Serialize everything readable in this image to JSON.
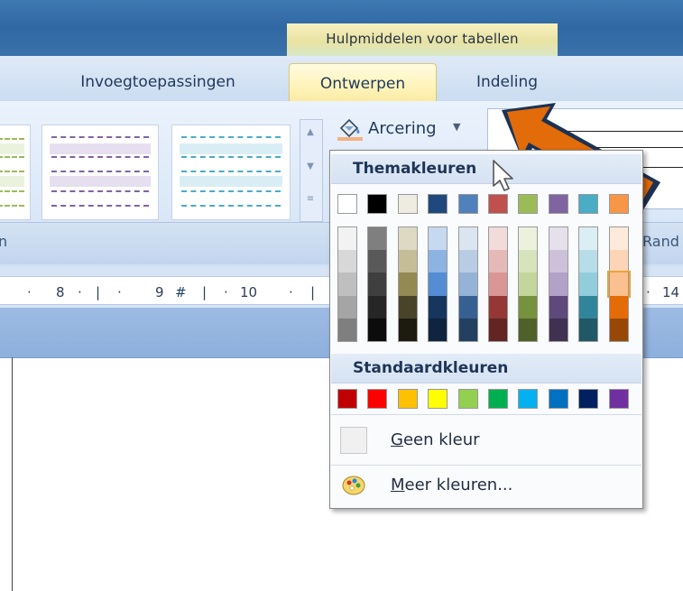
{
  "contextual_tab_title": "Hulpmiddelen voor tabellen",
  "tabs": [
    {
      "label": "Invoegtoepassingen"
    },
    {
      "label": "Ontwerpen"
    },
    {
      "label": "Indeling"
    }
  ],
  "ribbon": {
    "group_label_left": "n",
    "group_label_right": "Rand",
    "shading_button_label": "Arcering"
  },
  "ruler": {
    "labels": [
      "8",
      "9",
      "10",
      "14"
    ]
  },
  "dropdown": {
    "theme_header": "Themakleuren",
    "standard_header": "Standaardkleuren",
    "no_color_label": "Geen kleur",
    "no_color_accel": "G",
    "more_colors_label": "Meer kleuren...",
    "more_colors_accel": "M",
    "theme_top_row": [
      "#ffffff",
      "#000000",
      "#eeece1",
      "#1f497d",
      "#4f81bd",
      "#c0504d",
      "#9bbb59",
      "#8064a2",
      "#4bacc6",
      "#f79646"
    ],
    "theme_shades": [
      [
        "#f2f2f2",
        "#d8d8d8",
        "#bfbfbf",
        "#a5a5a5",
        "#7f7f7f"
      ],
      [
        "#7f7f7f",
        "#595959",
        "#3f3f3f",
        "#262626",
        "#0c0c0c"
      ],
      [
        "#ddd9c3",
        "#c4bd97",
        "#938953",
        "#494429",
        "#1d1b10"
      ],
      [
        "#c6d9f0",
        "#8db3e2",
        "#548dd4",
        "#17365d",
        "#0f243e"
      ],
      [
        "#dbe5f1",
        "#b8cce4",
        "#95b3d7",
        "#366092",
        "#244061"
      ],
      [
        "#f2dcdb",
        "#e5b9b7",
        "#d99694",
        "#953734",
        "#632423"
      ],
      [
        "#ebf1dd",
        "#d7e3bc",
        "#c3d69b",
        "#76923c",
        "#4f6128"
      ],
      [
        "#e5e0ec",
        "#ccc1d9",
        "#b2a2c7",
        "#5f497a",
        "#3f3151"
      ],
      [
        "#dbeef3",
        "#b7dde8",
        "#92cddc",
        "#31859b",
        "#205867"
      ],
      [
        "#fdeada",
        "#fbd5b5",
        "#fac08f",
        "#e36c09",
        "#974806"
      ]
    ],
    "standard_colors": [
      "#c00000",
      "#ff0000",
      "#ffc000",
      "#ffff00",
      "#92d050",
      "#00b050",
      "#00b0f0",
      "#0070c0",
      "#002060",
      "#7030a0"
    ]
  },
  "colors": {
    "accent_arrow": "#e26b0a",
    "ribbon_tab_active": "#fff3b8"
  }
}
